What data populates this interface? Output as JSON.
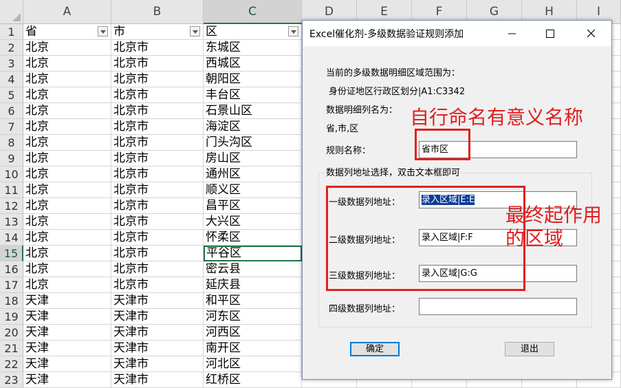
{
  "sheet": {
    "columns": [
      "A",
      "B",
      "C",
      "D",
      "E",
      "F",
      "G",
      "H",
      "I"
    ],
    "headers": [
      "省",
      "市",
      "区"
    ],
    "rows": [
      {
        "n": "2",
        "a": "北京",
        "b": "北京市",
        "c": "东城区"
      },
      {
        "n": "3",
        "a": "北京",
        "b": "北京市",
        "c": "西城区"
      },
      {
        "n": "4",
        "a": "北京",
        "b": "北京市",
        "c": "朝阳区"
      },
      {
        "n": "5",
        "a": "北京",
        "b": "北京市",
        "c": "丰台区"
      },
      {
        "n": "6",
        "a": "北京",
        "b": "北京市",
        "c": "石景山区"
      },
      {
        "n": "7",
        "a": "北京",
        "b": "北京市",
        "c": "海淀区"
      },
      {
        "n": "8",
        "a": "北京",
        "b": "北京市",
        "c": "门头沟区"
      },
      {
        "n": "9",
        "a": "北京",
        "b": "北京市",
        "c": "房山区"
      },
      {
        "n": "10",
        "a": "北京",
        "b": "北京市",
        "c": "通州区"
      },
      {
        "n": "11",
        "a": "北京",
        "b": "北京市",
        "c": "顺义区"
      },
      {
        "n": "12",
        "a": "北京",
        "b": "北京市",
        "c": "昌平区"
      },
      {
        "n": "13",
        "a": "北京",
        "b": "北京市",
        "c": "大兴区"
      },
      {
        "n": "14",
        "a": "北京",
        "b": "北京市",
        "c": "怀柔区"
      },
      {
        "n": "15",
        "a": "北京",
        "b": "北京市",
        "c": "平谷区"
      },
      {
        "n": "16",
        "a": "北京",
        "b": "北京市",
        "c": "密云县"
      },
      {
        "n": "17",
        "a": "北京",
        "b": "北京市",
        "c": "延庆县"
      },
      {
        "n": "18",
        "a": "天津",
        "b": "天津市",
        "c": "和平区"
      },
      {
        "n": "19",
        "a": "天津",
        "b": "天津市",
        "c": "河东区"
      },
      {
        "n": "20",
        "a": "天津",
        "b": "天津市",
        "c": "河西区"
      },
      {
        "n": "21",
        "a": "天津",
        "b": "天津市",
        "c": "南开区"
      },
      {
        "n": "22",
        "a": "天津",
        "b": "天津市",
        "c": "河北区"
      },
      {
        "n": "23",
        "a": "天津",
        "b": "天津市",
        "c": "红桥区"
      }
    ]
  },
  "dialog": {
    "title": "Excel催化剂-多级数据验证规则添加",
    "range_label": "当前的多级数据明细区域范围为：",
    "range_value": "身份证地区行政区划分|A1:C3342",
    "cols_label": "数据明细列名为：",
    "cols_value": "省,市,区",
    "rule_name_label": "规则名称：",
    "rule_name_value": "省市区",
    "group_label": "数据列地址选择，双击文本框即可",
    "level1_label": "一级数据列地址：",
    "level1_value": "录入区域|E:E",
    "level2_label": "二级数据列地址：",
    "level2_value": "录入区域|F:F",
    "level3_label": "三级数据列地址：",
    "level3_value": "录入区域|G:G",
    "level4_label": "四级数据列地址：",
    "level4_value": "",
    "ok_label": "确定",
    "cancel_label": "退出"
  },
  "annotations": {
    "name_note": "自行命名有意义名称",
    "range_note_line1": "最终起作用",
    "range_note_line2": "的区域",
    "color": "#e02020"
  }
}
